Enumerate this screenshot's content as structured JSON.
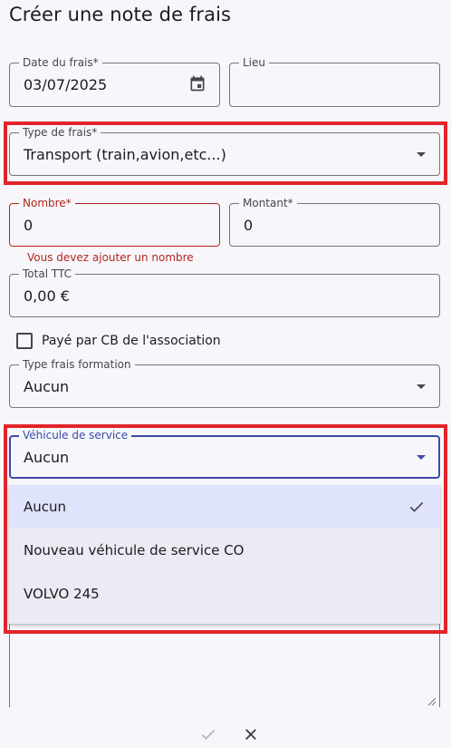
{
  "page": {
    "title": "Créer une note de frais"
  },
  "fields": {
    "date": {
      "label": "Date du frais*",
      "value": "03/07/2025",
      "icon": "calendar-icon"
    },
    "lieu": {
      "label": "Lieu",
      "value": ""
    },
    "type": {
      "label": "Type de frais*",
      "value": "Transport (train,avion,etc...)"
    },
    "nombre": {
      "label": "Nombre*",
      "value": "0",
      "error": "Vous devez ajouter un nombre"
    },
    "montant": {
      "label": "Montant*",
      "value": "0"
    },
    "total": {
      "label": "Total TTC",
      "value": "0,00 €"
    },
    "cb": {
      "label": "Payé par CB de l'association",
      "checked": false
    },
    "formation": {
      "label": "Type frais formation",
      "value": "Aucun"
    },
    "vehicule": {
      "label": "Véhicule de service",
      "value": "Aucun"
    }
  },
  "vehicule_menu": {
    "options": [
      {
        "label": "Aucun",
        "selected": true
      },
      {
        "label": "Nouveau véhicule de service CO",
        "selected": false
      },
      {
        "label": "VOLVO 245",
        "selected": false
      }
    ]
  },
  "colors": {
    "highlight": "#e2242a",
    "error": "#b3261e",
    "focus": "#3b4ba8"
  },
  "footer": {
    "confirm_icon": "check-icon",
    "cancel_icon": "close-icon"
  }
}
